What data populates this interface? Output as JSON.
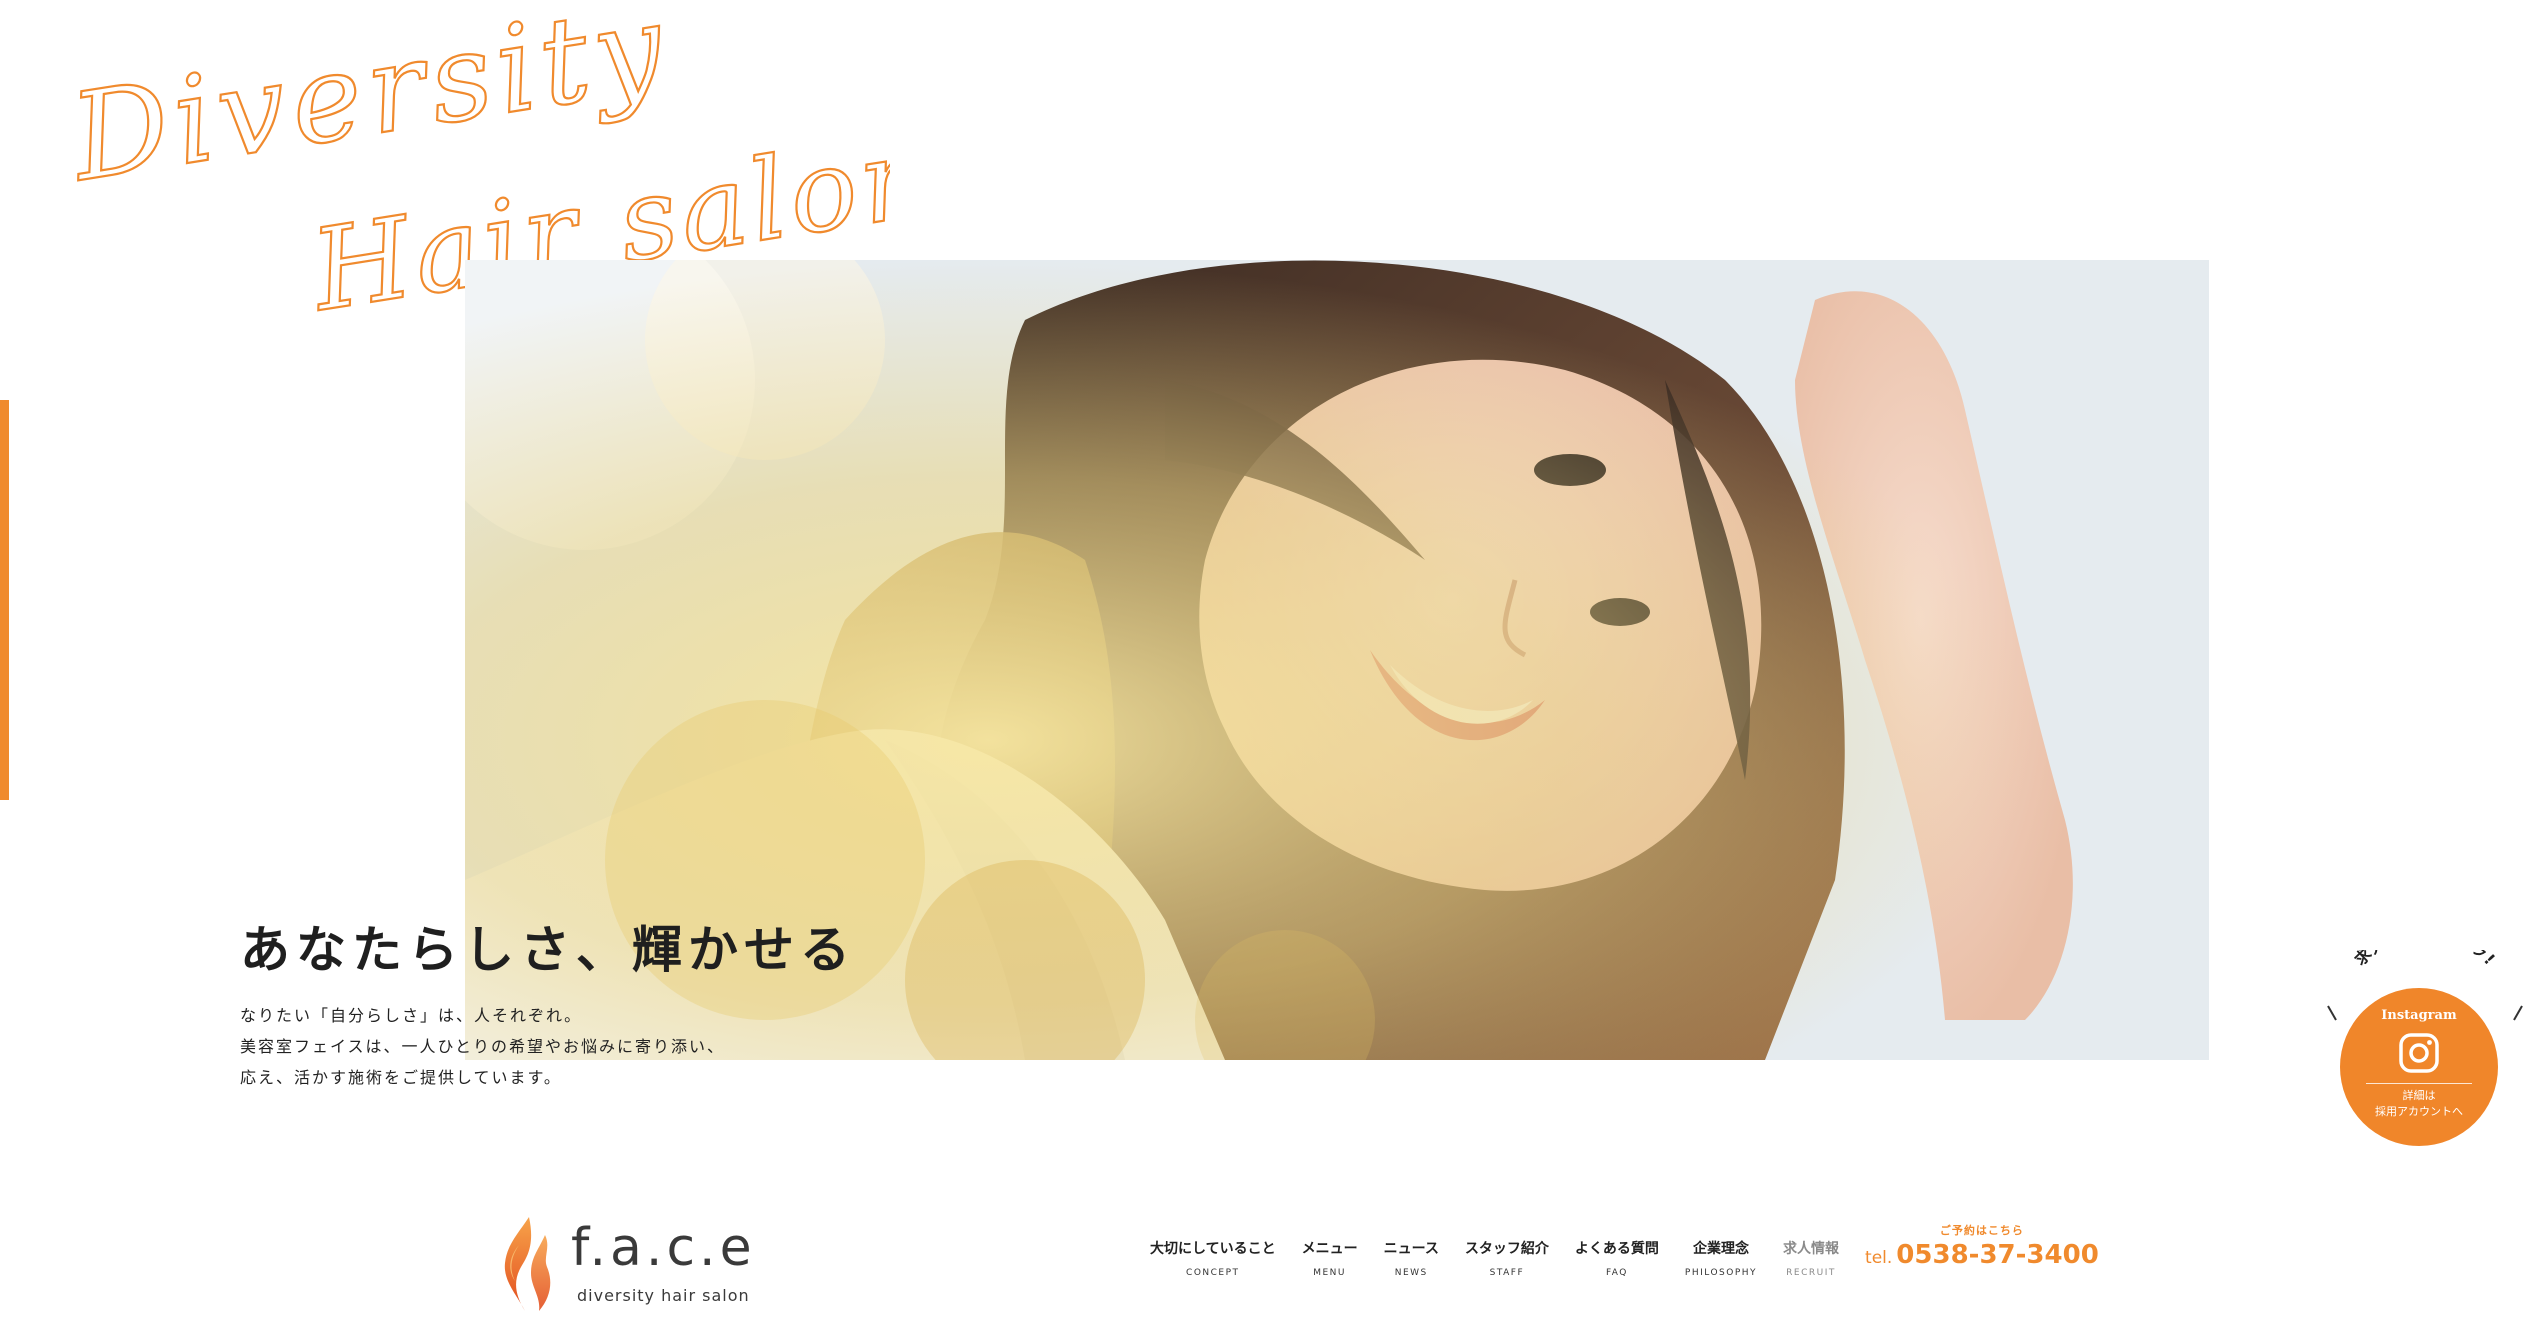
{
  "brand": {
    "script_line1": "Diversity",
    "script_line2": "Hair salon",
    "logo_name": "f.a.c.e",
    "logo_tagline": "diversity hair salon",
    "accent_color": "#f08a2d"
  },
  "hero": {
    "headline": "あなたらしさ、輝かせる",
    "body": [
      "なりたい「自分らしさ」は、人それぞれ。",
      "美容室フェイスは、一人ひとりの希望やお悩みに寄り添い、",
      "応え、活かす施術をご提供しています。"
    ]
  },
  "recruit_badge": {
    "arc_text": "求人情報はコチラ!",
    "platform": "Instagram",
    "icon": "instagram-icon",
    "detail_line1": "詳細は",
    "detail_line2": "採用アカウントへ"
  },
  "nav": {
    "items": [
      {
        "jp": "大切にしていること",
        "en": "CONCEPT"
      },
      {
        "jp": "メニュー",
        "en": "MENU"
      },
      {
        "jp": "ニュース",
        "en": "NEWS"
      },
      {
        "jp": "スタッフ紹介",
        "en": "STAFF"
      },
      {
        "jp": "よくある質問",
        "en": "FAQ"
      },
      {
        "jp": "企業理念",
        "en": "PHILOSOPHY"
      },
      {
        "jp": "求人情報",
        "en": "RECRUIT"
      }
    ],
    "reserve_lead": "ご予約はこちら",
    "tel_prefix": "tel.",
    "tel_number": "0538-37-3400"
  }
}
